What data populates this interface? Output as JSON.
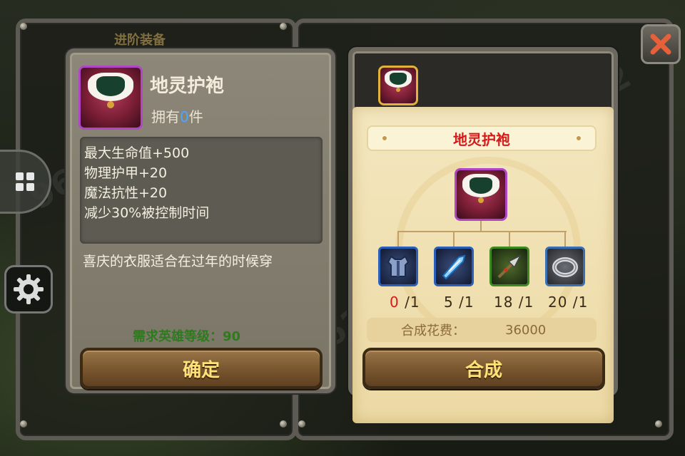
{
  "background": {
    "tab_label": "进阶装备"
  },
  "item_panel": {
    "name": "地灵护袍",
    "owned_prefix": "拥有",
    "owned_count": "0",
    "owned_suffix": "件",
    "stats": [
      "最大生命值+500",
      "物理护甲+20",
      "魔法抗性+20",
      "减少30%被控制时间"
    ],
    "description": "喜庆的衣服适合在过年的时候穿",
    "requirement": "需求英雄等级：90",
    "confirm_label": "确定",
    "icon": "fur-robe-icon"
  },
  "synthesis_panel": {
    "title": "地灵护袍",
    "materials": [
      {
        "icon": "armor-vest-icon",
        "have": "0",
        "need": "1"
      },
      {
        "icon": "ice-crystal-icon",
        "have": "5",
        "need": "1"
      },
      {
        "icon": "spear-tip-icon",
        "have": "18",
        "need": "1"
      },
      {
        "icon": "silver-ring-icon",
        "have": "20",
        "need": "1"
      }
    ],
    "cost_label": "合成花费：",
    "cost_value": "36000",
    "synthesize_label": "合成"
  },
  "colors": {
    "title_red": "#d41a1a",
    "button_text": "#ffe277",
    "requirement_green": "#2f7a1f",
    "owned_blue": "#4da6ff",
    "epic_border": "#b046c4"
  }
}
